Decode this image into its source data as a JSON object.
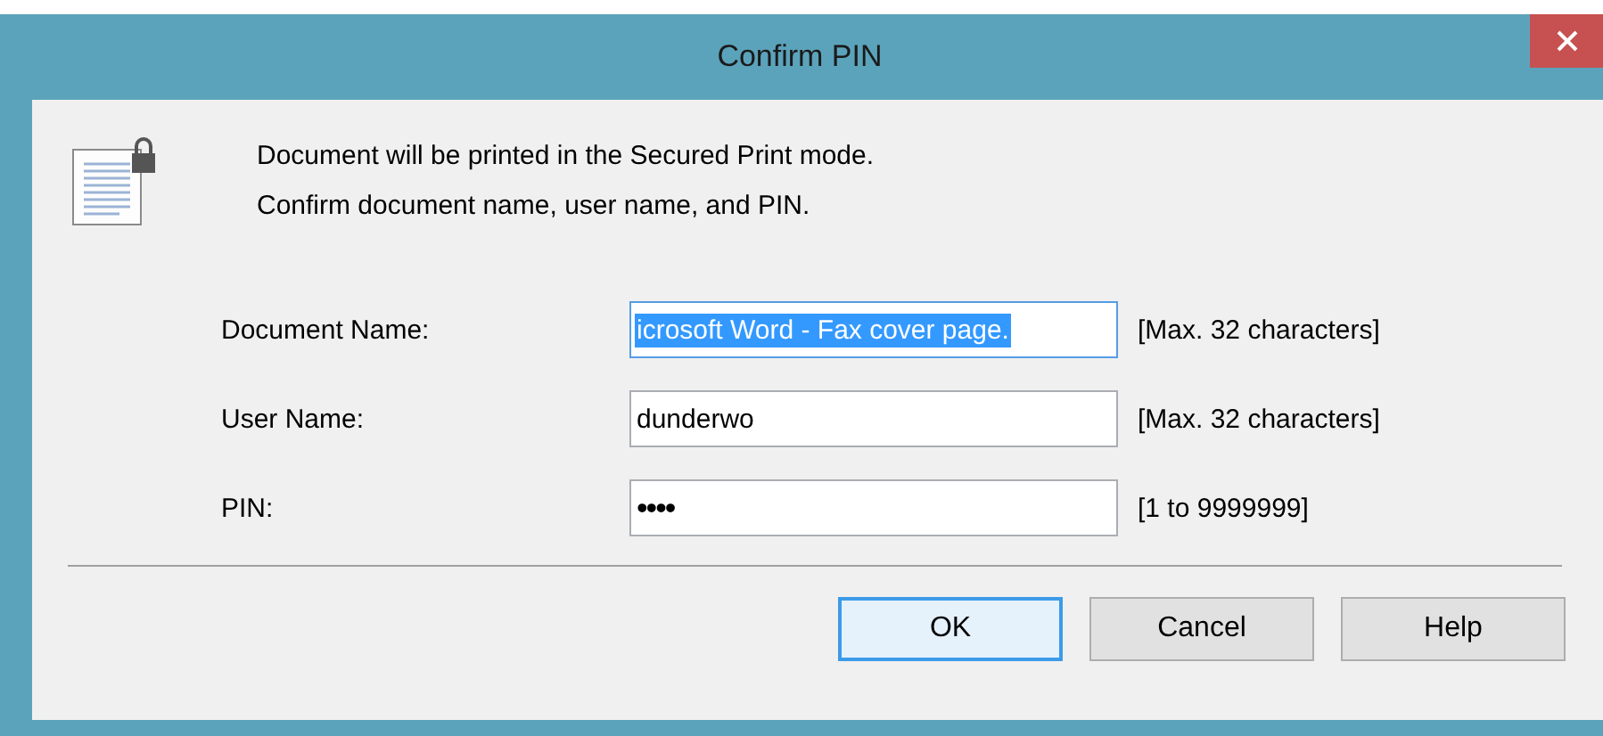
{
  "window": {
    "title": "Confirm PIN"
  },
  "message": [
    "Document will be printed in the Secured Print mode.",
    "Confirm document name, user name, and PIN."
  ],
  "fields": [
    {
      "label": "Document Name:",
      "value": "icrosoft Word - Fax cover page.",
      "selected": true,
      "hint": "[Max. 32 characters]"
    },
    {
      "label": "User Name:",
      "value": "dunderwo",
      "selected": false,
      "hint": "[Max. 32 characters]"
    },
    {
      "label": "PIN:",
      "value": "••••",
      "selected": false,
      "hint": "[1 to 9999999]"
    }
  ],
  "buttons": [
    {
      "label": "OK",
      "focused": true
    },
    {
      "label": "Cancel",
      "focused": false
    },
    {
      "label": "Help",
      "focused": false
    }
  ]
}
